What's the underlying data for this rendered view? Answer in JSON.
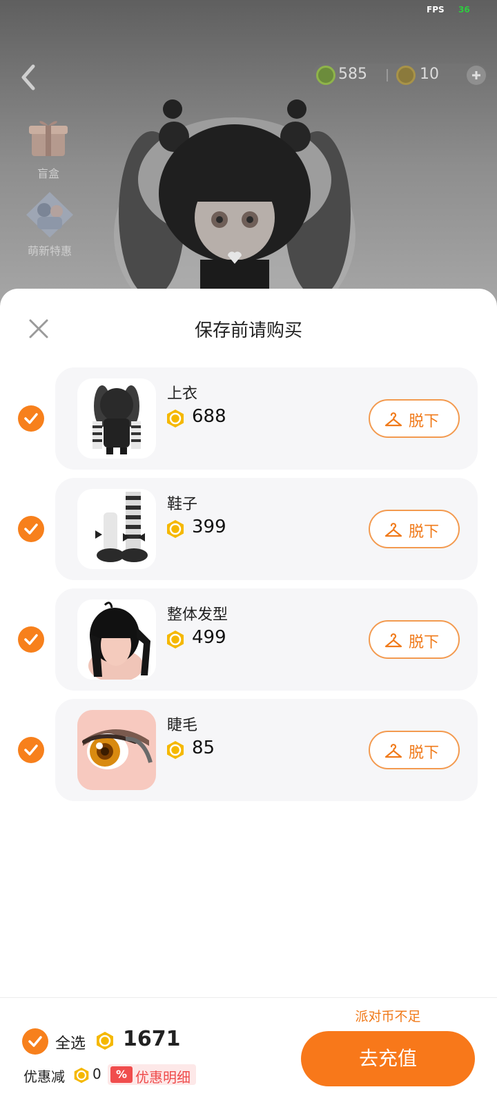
{
  "status": {
    "fps_label": "FPS",
    "fps_value": "36"
  },
  "header": {
    "currency_g": "585",
    "currency_coin": "10"
  },
  "side_menu": [
    {
      "label": "盲盒",
      "icon": "gift-box-icon"
    },
    {
      "label": "萌新特惠",
      "icon": "newbie-offer-icon"
    }
  ],
  "sheet": {
    "title": "保存前请购买",
    "items": [
      {
        "name": "上衣",
        "price": "688",
        "action": "脱下",
        "checked": true,
        "icon": "top-clothing-thumbnail"
      },
      {
        "name": "鞋子",
        "price": "399",
        "action": "脱下",
        "checked": true,
        "icon": "shoes-thumbnail"
      },
      {
        "name": "整体发型",
        "price": "499",
        "action": "脱下",
        "checked": true,
        "icon": "hairstyle-thumbnail"
      },
      {
        "name": "睫毛",
        "price": "85",
        "action": "脱下",
        "checked": true,
        "icon": "eyelash-thumbnail"
      }
    ]
  },
  "footer": {
    "select_all": "全选",
    "total": "1671",
    "discount_label": "优惠减",
    "discount_value": "0",
    "discount_badge": "%",
    "discount_detail": "优惠明细",
    "insufficient": "派对币不足",
    "recharge": "去充值"
  },
  "colors": {
    "accent": "#f7801c",
    "coin": "#f5b800",
    "danger": "#ef4b4b"
  }
}
